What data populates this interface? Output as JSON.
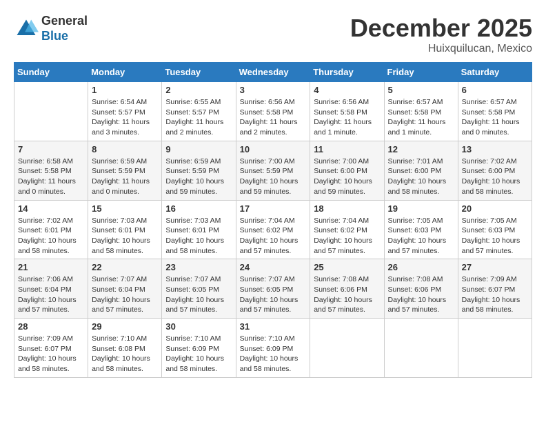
{
  "header": {
    "logo_general": "General",
    "logo_blue": "Blue",
    "month_title": "December 2025",
    "location": "Huixquilucan, Mexico"
  },
  "calendar": {
    "days_of_week": [
      "Sunday",
      "Monday",
      "Tuesday",
      "Wednesday",
      "Thursday",
      "Friday",
      "Saturday"
    ],
    "weeks": [
      [
        {
          "day": "",
          "info": ""
        },
        {
          "day": "1",
          "info": "Sunrise: 6:54 AM\nSunset: 5:57 PM\nDaylight: 11 hours\nand 3 minutes."
        },
        {
          "day": "2",
          "info": "Sunrise: 6:55 AM\nSunset: 5:57 PM\nDaylight: 11 hours\nand 2 minutes."
        },
        {
          "day": "3",
          "info": "Sunrise: 6:56 AM\nSunset: 5:58 PM\nDaylight: 11 hours\nand 2 minutes."
        },
        {
          "day": "4",
          "info": "Sunrise: 6:56 AM\nSunset: 5:58 PM\nDaylight: 11 hours\nand 1 minute."
        },
        {
          "day": "5",
          "info": "Sunrise: 6:57 AM\nSunset: 5:58 PM\nDaylight: 11 hours\nand 1 minute."
        },
        {
          "day": "6",
          "info": "Sunrise: 6:57 AM\nSunset: 5:58 PM\nDaylight: 11 hours\nand 0 minutes."
        }
      ],
      [
        {
          "day": "7",
          "info": "Sunrise: 6:58 AM\nSunset: 5:58 PM\nDaylight: 11 hours\nand 0 minutes."
        },
        {
          "day": "8",
          "info": "Sunrise: 6:59 AM\nSunset: 5:59 PM\nDaylight: 11 hours\nand 0 minutes."
        },
        {
          "day": "9",
          "info": "Sunrise: 6:59 AM\nSunset: 5:59 PM\nDaylight: 10 hours\nand 59 minutes."
        },
        {
          "day": "10",
          "info": "Sunrise: 7:00 AM\nSunset: 5:59 PM\nDaylight: 10 hours\nand 59 minutes."
        },
        {
          "day": "11",
          "info": "Sunrise: 7:00 AM\nSunset: 6:00 PM\nDaylight: 10 hours\nand 59 minutes."
        },
        {
          "day": "12",
          "info": "Sunrise: 7:01 AM\nSunset: 6:00 PM\nDaylight: 10 hours\nand 58 minutes."
        },
        {
          "day": "13",
          "info": "Sunrise: 7:02 AM\nSunset: 6:00 PM\nDaylight: 10 hours\nand 58 minutes."
        }
      ],
      [
        {
          "day": "14",
          "info": "Sunrise: 7:02 AM\nSunset: 6:01 PM\nDaylight: 10 hours\nand 58 minutes."
        },
        {
          "day": "15",
          "info": "Sunrise: 7:03 AM\nSunset: 6:01 PM\nDaylight: 10 hours\nand 58 minutes."
        },
        {
          "day": "16",
          "info": "Sunrise: 7:03 AM\nSunset: 6:01 PM\nDaylight: 10 hours\nand 58 minutes."
        },
        {
          "day": "17",
          "info": "Sunrise: 7:04 AM\nSunset: 6:02 PM\nDaylight: 10 hours\nand 57 minutes."
        },
        {
          "day": "18",
          "info": "Sunrise: 7:04 AM\nSunset: 6:02 PM\nDaylight: 10 hours\nand 57 minutes."
        },
        {
          "day": "19",
          "info": "Sunrise: 7:05 AM\nSunset: 6:03 PM\nDaylight: 10 hours\nand 57 minutes."
        },
        {
          "day": "20",
          "info": "Sunrise: 7:05 AM\nSunset: 6:03 PM\nDaylight: 10 hours\nand 57 minutes."
        }
      ],
      [
        {
          "day": "21",
          "info": "Sunrise: 7:06 AM\nSunset: 6:04 PM\nDaylight: 10 hours\nand 57 minutes."
        },
        {
          "day": "22",
          "info": "Sunrise: 7:07 AM\nSunset: 6:04 PM\nDaylight: 10 hours\nand 57 minutes."
        },
        {
          "day": "23",
          "info": "Sunrise: 7:07 AM\nSunset: 6:05 PM\nDaylight: 10 hours\nand 57 minutes."
        },
        {
          "day": "24",
          "info": "Sunrise: 7:07 AM\nSunset: 6:05 PM\nDaylight: 10 hours\nand 57 minutes."
        },
        {
          "day": "25",
          "info": "Sunrise: 7:08 AM\nSunset: 6:06 PM\nDaylight: 10 hours\nand 57 minutes."
        },
        {
          "day": "26",
          "info": "Sunrise: 7:08 AM\nSunset: 6:06 PM\nDaylight: 10 hours\nand 57 minutes."
        },
        {
          "day": "27",
          "info": "Sunrise: 7:09 AM\nSunset: 6:07 PM\nDaylight: 10 hours\nand 58 minutes."
        }
      ],
      [
        {
          "day": "28",
          "info": "Sunrise: 7:09 AM\nSunset: 6:07 PM\nDaylight: 10 hours\nand 58 minutes."
        },
        {
          "day": "29",
          "info": "Sunrise: 7:10 AM\nSunset: 6:08 PM\nDaylight: 10 hours\nand 58 minutes."
        },
        {
          "day": "30",
          "info": "Sunrise: 7:10 AM\nSunset: 6:09 PM\nDaylight: 10 hours\nand 58 minutes."
        },
        {
          "day": "31",
          "info": "Sunrise: 7:10 AM\nSunset: 6:09 PM\nDaylight: 10 hours\nand 58 minutes."
        },
        {
          "day": "",
          "info": ""
        },
        {
          "day": "",
          "info": ""
        },
        {
          "day": "",
          "info": ""
        }
      ]
    ]
  }
}
